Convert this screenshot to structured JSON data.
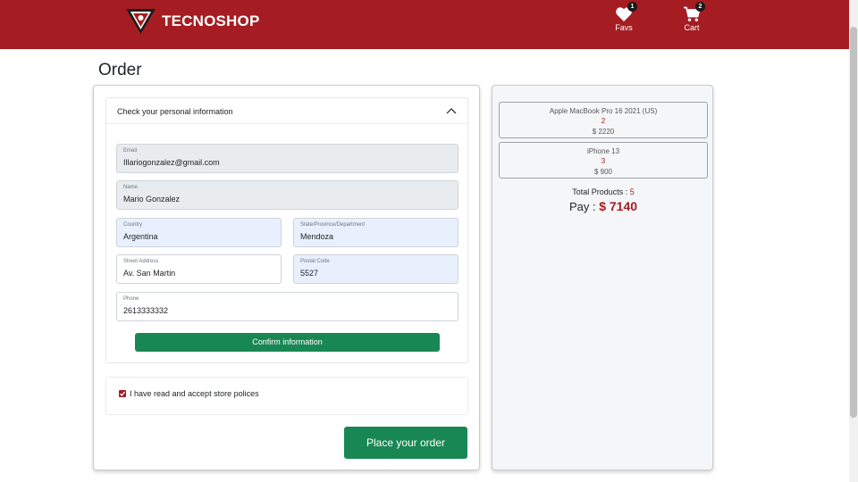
{
  "brand": {
    "name": "TECNOSHOP"
  },
  "nav": {
    "favs": {
      "label": "Favs",
      "count": "1",
      "icon": "heart-icon"
    },
    "cart": {
      "label": "Cart",
      "count": "2",
      "icon": "cart-icon"
    }
  },
  "page": {
    "title": "Order"
  },
  "personal_info": {
    "title": "Check your personal information",
    "fields": {
      "email": {
        "label": "Email",
        "value": "Illariogonzalez@gmail.com"
      },
      "name": {
        "label": "Name",
        "value": "Mario Gonzalez"
      },
      "country": {
        "label": "Country",
        "value": "Argentina"
      },
      "state": {
        "label": "State/Province/Department",
        "value": "Mendoza"
      },
      "street": {
        "label": "Street Address",
        "value": "Av. San Martin"
      },
      "postal": {
        "label": "Postal Code",
        "value": "5527"
      },
      "phone": {
        "label": "Phone",
        "value": "2613333332"
      }
    },
    "confirm_label": "Confirm information"
  },
  "policies": {
    "label": "I have read and accept store polices",
    "checked": true
  },
  "place_order_label": "Place your order",
  "summary": {
    "products": [
      {
        "name": "Apple MacBook Pro 16 2021 (US)",
        "qty": "2",
        "price": "$ 2220"
      },
      {
        "name": "iPhone 13",
        "qty": "3",
        "price": "$ 900"
      }
    ],
    "total_label": "Total Products :",
    "total_count": "5",
    "pay_label": "Pay :",
    "pay_amount": "$ 7140"
  },
  "colors": {
    "brand": "#a51d22",
    "success": "#198754"
  }
}
